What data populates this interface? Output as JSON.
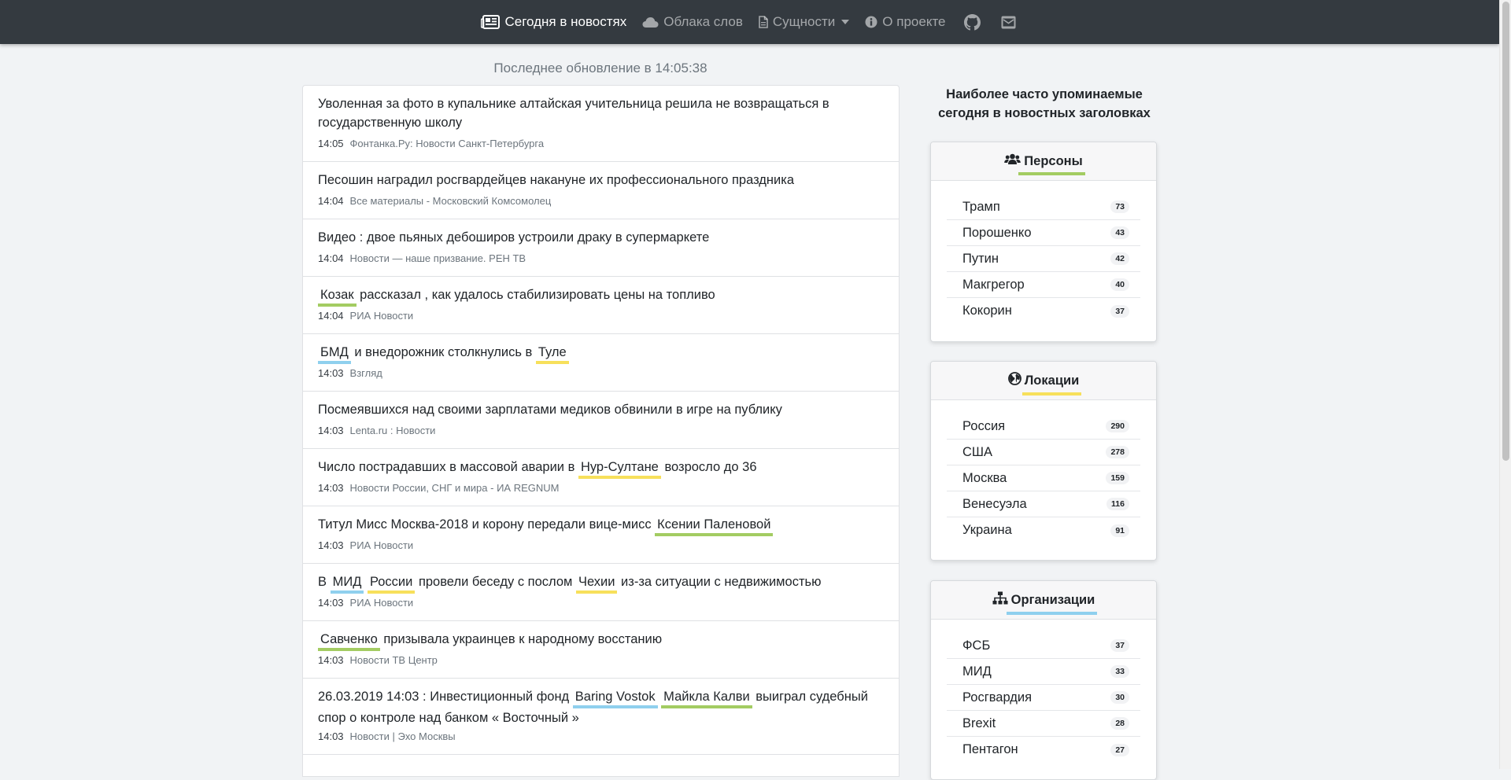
{
  "nav": {
    "items": [
      {
        "label": "Сегодня в новостях",
        "icon": "newspaper-icon"
      },
      {
        "label": "Облака слов",
        "icon": "cloud-icon"
      },
      {
        "label": "Сущности",
        "icon": "file-icon"
      },
      {
        "label": "О проекте",
        "icon": "info-circle-icon"
      }
    ],
    "github_icon": "github-icon",
    "mail_icon": "envelope-icon"
  },
  "last_update": "Последнее обновление в 14:05:38",
  "news": [
    {
      "title": [
        {
          "t": "Уволенная за фото в купальнике алтайская учительница решила не возвращаться в государственную школу"
        }
      ],
      "time": "14:05",
      "source": "Фонтанка.Ру: Новости Санкт-Петербурга"
    },
    {
      "title": [
        {
          "t": "Песошин наградил росгвардейцев накануне их профессионального праздника"
        }
      ],
      "time": "14:04",
      "source": "Все материалы - Московский Комсомолец"
    },
    {
      "title": [
        {
          "t": "Видео : двое пьяных дебоширов устроили драку в супермаркете"
        }
      ],
      "time": "14:04",
      "source": "Новости — наше призвание. РЕН ТВ"
    },
    {
      "title": [
        {
          "t": "Козак",
          "e": "per"
        },
        {
          "t": " рассказал , как удалось стабилизировать цены на топливо"
        }
      ],
      "time": "14:04",
      "source": "РИА Новости"
    },
    {
      "title": [
        {
          "t": "БМД",
          "e": "org"
        },
        {
          "t": " и внедорожник столкнулись в "
        },
        {
          "t": "Туле",
          "e": "loc"
        }
      ],
      "time": "14:03",
      "source": "Взгляд"
    },
    {
      "title": [
        {
          "t": "Посмеявшихся над своими зарплатами медиков обвинили в игре на публику"
        }
      ],
      "time": "14:03",
      "source": "Lenta.ru : Новости"
    },
    {
      "title": [
        {
          "t": "Число пострадавших в массовой аварии в "
        },
        {
          "t": "Нур-Султане",
          "e": "loc"
        },
        {
          "t": " возросло до 36"
        }
      ],
      "time": "14:03",
      "source": "Новости России, СНГ и мира - ИА REGNUM"
    },
    {
      "title": [
        {
          "t": "Титул Мисс Москва-2018 и корону передали вице-мисс "
        },
        {
          "t": "Ксении Паленовой",
          "e": "per"
        }
      ],
      "time": "14:03",
      "source": "РИА Новости"
    },
    {
      "title": [
        {
          "t": "В "
        },
        {
          "t": "МИД",
          "e": "org"
        },
        {
          "t": " "
        },
        {
          "t": "России",
          "e": "loc"
        },
        {
          "t": " провели беседу с послом "
        },
        {
          "t": "Чехии",
          "e": "loc"
        },
        {
          "t": " из-за ситуации с недвижимостью"
        }
      ],
      "time": "14:03",
      "source": "РИА Новости"
    },
    {
      "title": [
        {
          "t": "Савченко",
          "e": "per"
        },
        {
          "t": " призывала украинцев к народному восстанию"
        }
      ],
      "time": "14:03",
      "source": "Новости ТВ Центр"
    },
    {
      "title": [
        {
          "t": "26.03.2019 14:03 : Инвестиционный фонд "
        },
        {
          "t": "Baring Vostok",
          "e": "org"
        },
        {
          "t": " "
        },
        {
          "t": "Майкла Калви",
          "e": "per"
        },
        {
          "t": " выиграл судебный спор о контроле над банком « Восточный »"
        }
      ],
      "time": "14:03",
      "source": "Новости | Эхо Москвы"
    }
  ],
  "sidebar": {
    "heading": "Наиболее часто упоминаемые сегодня в новостных заголовках",
    "persons": {
      "title": "Персоны",
      "icon": "users-icon",
      "accent": "#a3cc62",
      "items": [
        {
          "label": "Трамп",
          "count": "73"
        },
        {
          "label": "Порошенко",
          "count": "43"
        },
        {
          "label": "Путин",
          "count": "42"
        },
        {
          "label": "Макгрегор",
          "count": "40"
        },
        {
          "label": "Кокорин",
          "count": "37"
        }
      ]
    },
    "locations": {
      "title": "Локации",
      "icon": "globe-icon",
      "accent": "#f7e05b",
      "items": [
        {
          "label": "Россия",
          "count": "290"
        },
        {
          "label": "США",
          "count": "278"
        },
        {
          "label": "Москва",
          "count": "159"
        },
        {
          "label": "Венесуэла",
          "count": "116"
        },
        {
          "label": "Украина",
          "count": "91"
        }
      ]
    },
    "organizations": {
      "title": "Организации",
      "icon": "sitemap-icon",
      "accent": "#8fd0ee",
      "items": [
        {
          "label": "ФСБ",
          "count": "37"
        },
        {
          "label": "МИД",
          "count": "33"
        },
        {
          "label": "Росгвардия",
          "count": "30"
        },
        {
          "label": "Brexit",
          "count": "28"
        },
        {
          "label": "Пентагон",
          "count": "27"
        }
      ]
    }
  }
}
